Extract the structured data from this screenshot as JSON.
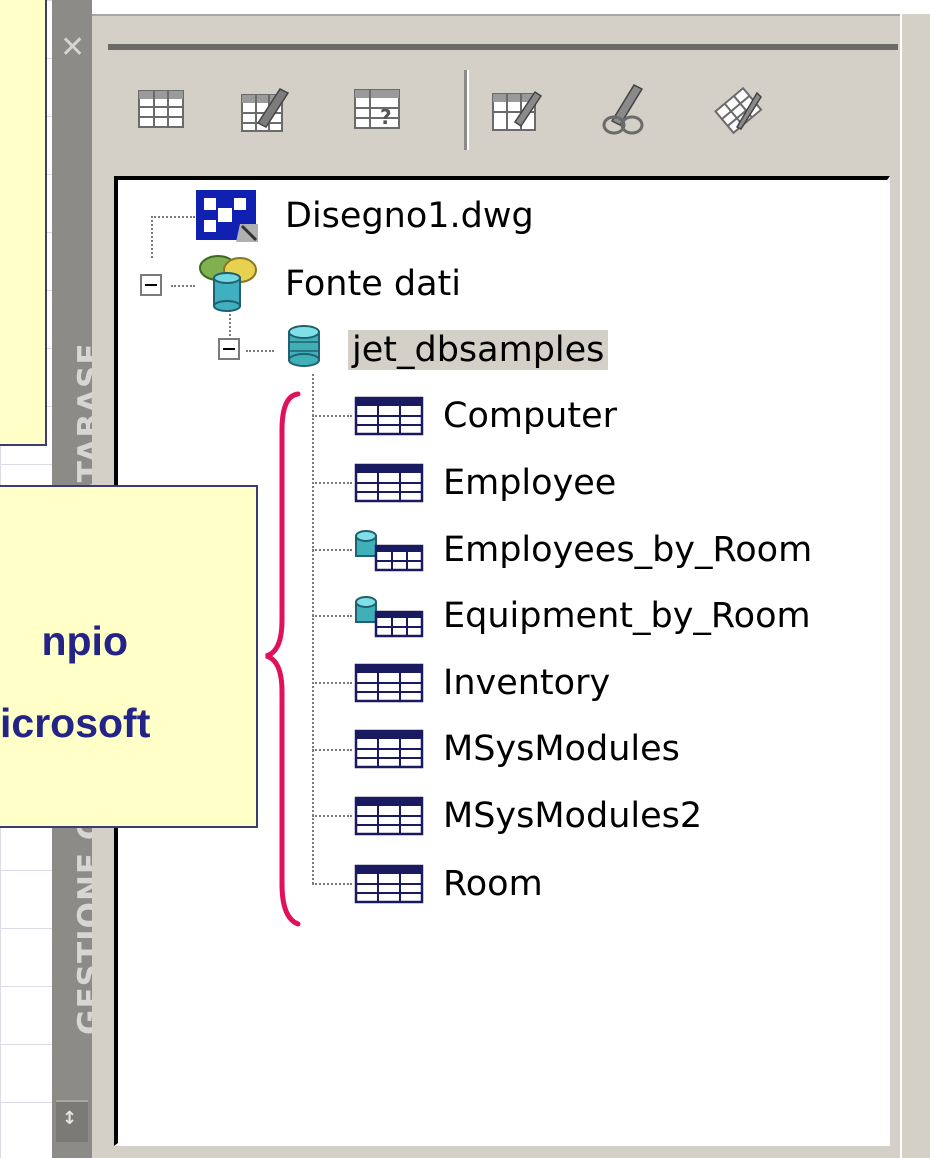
{
  "palette": {
    "title": "GESTIONE COLLEGAMENTO DATABASE",
    "close_glyph": "✕",
    "bottom_glyph": "↕"
  },
  "toolbar": {
    "buttons": [
      {
        "name": "view-table-icon"
      },
      {
        "name": "edit-table-icon"
      },
      {
        "name": "new-query-icon"
      },
      {
        "name": "new-link-template-icon"
      },
      {
        "name": "new-label-template-icon"
      },
      {
        "name": "synchronize-icon"
      }
    ]
  },
  "tree": {
    "drawing": "Disegno1.dwg",
    "data_sources": "Fonte dati",
    "database": "jet_dbsamples",
    "items": [
      {
        "label": "Computer",
        "icon": "table-icon"
      },
      {
        "label": "Employee",
        "icon": "table-icon"
      },
      {
        "label": "Employees_by_Room",
        "icon": "query-icon"
      },
      {
        "label": "Equipment_by_Room",
        "icon": "query-icon"
      },
      {
        "label": "Inventory",
        "icon": "table-icon"
      },
      {
        "label": "MSysModules",
        "icon": "table-icon"
      },
      {
        "label": "MSysModules2",
        "icon": "table-icon"
      },
      {
        "label": "Room",
        "icon": "table-icon"
      }
    ]
  },
  "callouts": {
    "line1": "npio",
    "line2": "icrosoft"
  },
  "colors": {
    "brace": "#e0105a",
    "callout_fill": "#ffffc8",
    "callout_text": "#232388",
    "panel": "#d4d0c8"
  }
}
